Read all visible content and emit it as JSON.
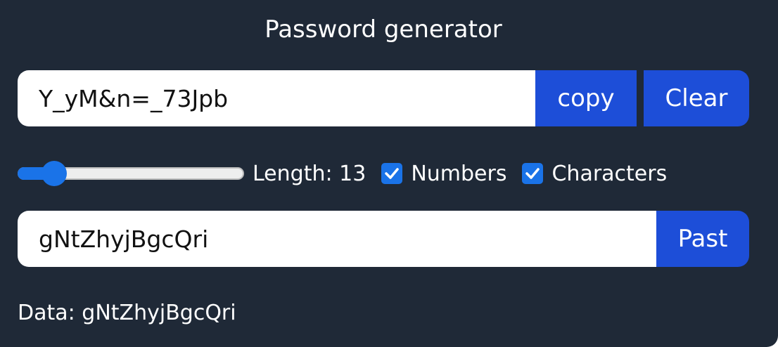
{
  "app": {
    "title": "Password generator"
  },
  "generator": {
    "password_value": "Y_yM&n=_73Jpb",
    "copy_label": "copy",
    "clear_label": "Clear"
  },
  "options": {
    "length_label": "Length:",
    "length_value": "13",
    "length_slider_fraction": 0.12,
    "numbers_label": "Numbers",
    "numbers_checked": true,
    "characters_label": "Characters",
    "characters_checked": true
  },
  "paste": {
    "input_value": "gNtZhyjBgcQri",
    "past_label": "Past"
  },
  "data_line": {
    "prefix": "Data:",
    "value": "gNtZhyjBgcQri"
  },
  "colors": {
    "panel_bg": "#1f2937",
    "accent": "#1d4ed8",
    "checkbox": "#1a73e8"
  },
  "icons": {
    "checkmark": "check-icon"
  }
}
